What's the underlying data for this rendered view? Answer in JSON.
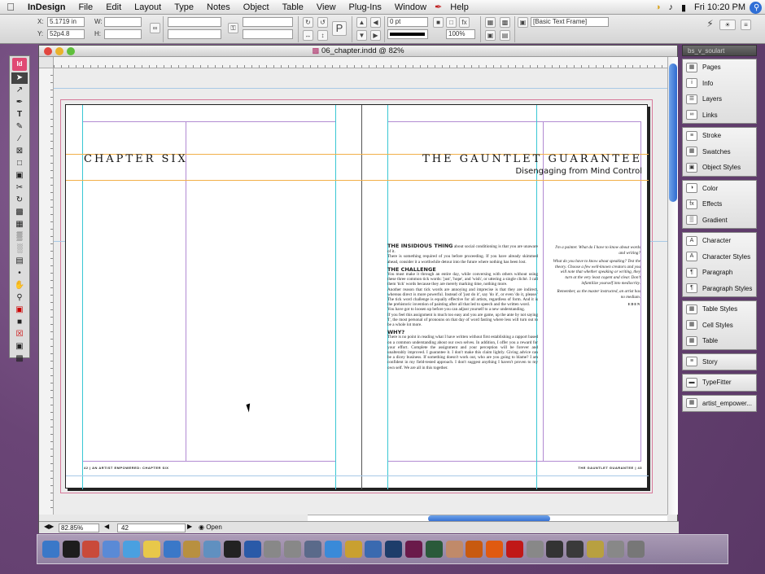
{
  "menubar": {
    "app": "InDesign",
    "items": [
      "File",
      "Edit",
      "Layout",
      "Type",
      "Notes",
      "Object",
      "Table",
      "View",
      "Plug-Ins",
      "Window",
      "Help"
    ],
    "clock": "Fri 10:20 PM"
  },
  "control": {
    "x": "5.1719 in",
    "y": "52p4.8",
    "w_label": "W:",
    "h_label": "H:",
    "x_label": "X:",
    "y_label": "Y:",
    "stroke": "0 pt",
    "zoom_pct": "100%",
    "style": "[Basic Text Frame]"
  },
  "doc": {
    "title": "06_chapter.indd @ 82%",
    "zoom": "82.85%",
    "page": "42",
    "status": "Open"
  },
  "spread": {
    "left_heading": "CHAPTER SIX",
    "right_heading": "THE GAUNTLET GUARANTEE",
    "right_sub": "Disengaging from Mind Control",
    "left_footer": "42 | AN ARTIST EMPOWERED: CHAPTER SIX",
    "right_footer": "THE GAUNTLET GUARANTEE | 43",
    "s1_head": "THE INSIDIOUS THING",
    "s1_p1": "about social conditioning is that you are unaware of it.",
    "s1_p2": "There is something required of you before proceeding. If you have already skimmed ahead, consider it a worthwhile detour into the future where nothing has been lost.",
    "s2_head": "THE CHALLENGE",
    "s2_p1": "You must make it through an entire day, while conversing with others without using these three common tick words: 'just', 'hope', and 'wish', or uttering a single cliché. I call them 'tick' words because they are merely marking time, nothing more.",
    "s2_p2": "Another reason that tick words are annoying and imprecise is that they are indirect, whereas direct is more powerful. Instead of 'just do it', say 'do it', or even 'do it, please.' The tick word challenge is equally effective for all artists, regardless of form. And it is the prehistoric invention of painting after all that led to speech and the written word.",
    "s2_p3": "You have got to loosen up before you can adjust yourself to a new understanding.",
    "s2_p4": "If you feel this assignment is much too easy and you are game, up the ante by not saying 'I', the most personal of pronouns on that day of word fasting where less will turn out to be a whole lot more.",
    "s3_head": "WHY?",
    "s3_p1": "There is no point in reading what I have written without first establishing a rapport based on a common understanding about our own selves. In addition, I offer you a reward for your effort. Complete the assignment and your perception will be forever and unalterably improved. I guarantee it. I don't make this claim lightly. Giving advice can be a dicey business. If something doesn't work out, who are you going to blame? I am confident in my field-tested approach. I don't suggest anything I haven't proven to my own self. We are all in this together.",
    "quote1": "I'm a painter. What do I have to know about words and writing?",
    "quote2": "What do you have to know about speaking? Test the theory. Choose a few well-known creators and you will note that whether speaking or writing, they turn at the very least cogent and clear. Don't infantilize yourself into mediocrity.",
    "quote3": "Remember, as the master instructed, an artist has no medium.",
    "quote_sig": "EDEN"
  },
  "panels": {
    "title": "bs_v_soulart",
    "groups": [
      [
        "Pages",
        "Info",
        "Layers",
        "Links"
      ],
      [
        "Stroke",
        "Swatches",
        "Object Styles"
      ],
      [
        "Color",
        "Effects",
        "Gradient"
      ],
      [
        "Character",
        "Character Styles",
        "Paragraph",
        "Paragraph Styles"
      ],
      [
        "Table Styles",
        "Cell Styles",
        "Table"
      ],
      [
        "Story"
      ],
      [
        "TypeFitter"
      ],
      [
        "artist_empower..."
      ]
    ]
  },
  "dock_apps": [
    "Finder",
    "Dashboard",
    "iCal",
    "Mail",
    "iTunes",
    "Stickies",
    "Preview",
    "Chess",
    "Photo",
    "Terminal",
    "Word",
    "Grab",
    "Prefs",
    "iMovie",
    "Safari",
    "Pencil",
    "Xcode",
    "Ps",
    "Id",
    "Dw",
    "Hand",
    "Ai",
    "Firefox",
    "Acrobat",
    "Fontbook",
    "Quill",
    "Magnet",
    "Key",
    "Scan",
    "Trash"
  ]
}
